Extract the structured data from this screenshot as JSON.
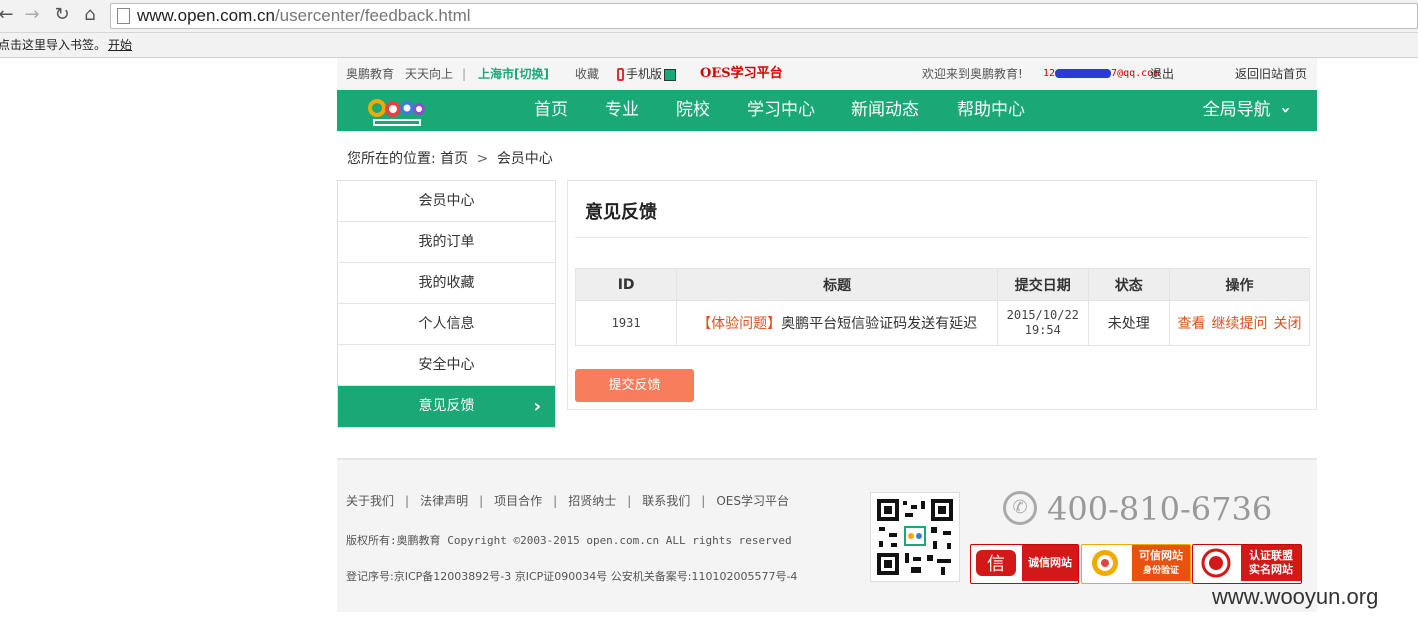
{
  "browser": {
    "url_host": "www.open.com.cn",
    "url_path": "/usercenter/feedback.html",
    "bookmark_hint": "点击这里导入书签。",
    "bookmark_start": "开始"
  },
  "topbar": {
    "brand": "奥鹏教育",
    "slogan": "天天向上",
    "city": "上海市[切换]",
    "favorite": "收藏",
    "mobile": "手机版",
    "oes": "OES学习平台",
    "welcome": "欢迎来到奥鹏教育!",
    "email_prefix": "12",
    "email_suffix": "7@qq.com",
    "logout": "退出",
    "old_site": "返回旧站首页"
  },
  "nav": {
    "items": [
      "首页",
      "专业",
      "院校",
      "学习中心",
      "新闻动态",
      "帮助中心"
    ],
    "global": "全局导航"
  },
  "breadcrumb": {
    "label": "您所在的位置:",
    "home": "首页",
    "sep": ">",
    "current": "会员中心"
  },
  "sidebar": {
    "items": [
      "会员中心",
      "我的订单",
      "我的收藏",
      "个人信息",
      "安全中心",
      "意见反馈"
    ],
    "active_index": 5
  },
  "panel": {
    "title": "意见反馈",
    "columns": [
      "ID",
      "标题",
      "提交日期",
      "状态",
      "操作"
    ],
    "rows": [
      {
        "id": "1931",
        "category": "【体验问题】",
        "title": "奥鹏平台短信验证码发送有延迟",
        "date": "2015/10/22",
        "time": "19:54",
        "status": "未处理",
        "ops": [
          "查看",
          "继续提问",
          "关闭"
        ]
      }
    ],
    "submit_label": "提交反馈"
  },
  "footer": {
    "links": [
      "关于我们",
      "法律声明",
      "项目合作",
      "招贤纳士",
      "联系我们",
      "OES学习平台"
    ],
    "copyright": "版权所有:奥鹏教育 Copyright ©2003-2015 open.com.cn ALL rights reserved",
    "icp": "登记序号:京ICP备12003892号-3 京ICP证090034号  公安机关备案号:110102005577号-4",
    "hotline": "400-810-6736",
    "badges": [
      {
        "line1": "诚信网站",
        "line2": ""
      },
      {
        "line1": "可信网站",
        "line2": "身份验证"
      },
      {
        "line1": "认证联盟",
        "line2": "实名网站"
      }
    ]
  },
  "watermark": "www.wooyun.org",
  "colors": {
    "brand_green": "#1aa877",
    "accent_orange": "#d9531e",
    "button_salmon": "#f87d5d",
    "badge_red": "#d31818"
  }
}
